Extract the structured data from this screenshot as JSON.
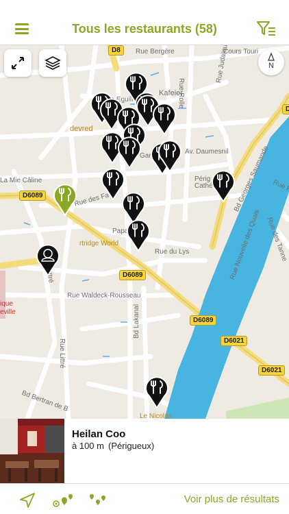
{
  "header": {
    "title": "Tous les restaurants (58)",
    "menu_icon": "hamburger-menu-icon",
    "filter_icon": "filter-icon",
    "accent_color": "#8aa824"
  },
  "map": {
    "controls": {
      "fullscreen_icon": "expand-icon",
      "layers_icon": "layers-icon",
      "compass_label": "N"
    },
    "roads": [
      {
        "id": "d8",
        "text": "D8",
        "type": "badge"
      },
      {
        "id": "d6089a",
        "text": "D6089",
        "type": "badge"
      },
      {
        "id": "d6089b",
        "text": "D6089",
        "type": "badge"
      },
      {
        "id": "d6089c",
        "text": "D6089",
        "type": "badge"
      },
      {
        "id": "d6021a",
        "text": "D6021",
        "type": "badge"
      },
      {
        "id": "d6021b",
        "text": "D6021",
        "type": "badge"
      },
      {
        "id": "dtop",
        "text": "D",
        "type": "badge"
      }
    ],
    "labels": [
      {
        "id": "bergere",
        "text": "Rue Bergère"
      },
      {
        "id": "cours",
        "text": "Cours Touri"
      },
      {
        "id": "rolle",
        "text": "Rue Rolle"
      },
      {
        "id": "kafeier",
        "text": "Kafeier"
      },
      {
        "id": "judaique",
        "text": "Rue Judaïque"
      },
      {
        "id": "eguillerie",
        "text": "ue Eguill"
      },
      {
        "id": "daumesnil",
        "text": "Av. Daumesnil"
      },
      {
        "id": "devred",
        "text": "devred"
      },
      {
        "id": "saumande",
        "text": "Bd Georges Saumande"
      },
      {
        "id": "mie",
        "text": "La Mie Câline"
      },
      {
        "id": "perig",
        "text": "Périg"
      },
      {
        "id": "cathe",
        "text": "Cathé"
      },
      {
        "id": "ruep",
        "text": "Rue P"
      },
      {
        "id": "fais",
        "text": "Rue des Fa"
      },
      {
        "id": "partridge",
        "text": "rtridge World"
      },
      {
        "id": "papa",
        "text": "Papa"
      },
      {
        "id": "lys",
        "text": "Rue du Lys"
      },
      {
        "id": "quais",
        "text": "Rue Nouvelle des Quais"
      },
      {
        "id": "tann",
        "text": "Rue des Tanne"
      },
      {
        "id": "waldeck",
        "text": "Rue Waldeck-Rousseau"
      },
      {
        "id": "littre1",
        "text": "Littré"
      },
      {
        "id": "littre2",
        "text": "Rue Littré"
      },
      {
        "id": "lakanal",
        "text": "Bd Lakanal"
      },
      {
        "id": "bertran",
        "text": "Bd Bertran de B"
      },
      {
        "id": "ique",
        "text": "ique"
      },
      {
        "id": "eville",
        "text": "eville"
      },
      {
        "id": "ng",
        "text": "Gar"
      },
      {
        "id": "nicolas",
        "text": "Le Nicolas"
      }
    ],
    "pins": [
      {
        "name": "restaurant-pin",
        "icon": "fork-knife-icon"
      },
      {
        "name": "restaurant-pin",
        "icon": "fork-knife-icon"
      },
      {
        "name": "restaurant-pin",
        "icon": "fork-knife-icon"
      },
      {
        "name": "restaurant-pin",
        "icon": "fork-knife-icon"
      },
      {
        "name": "restaurant-pin",
        "icon": "fork-knife-icon"
      },
      {
        "name": "restaurant-pin",
        "icon": "fork-knife-icon"
      },
      {
        "name": "restaurant-pin",
        "icon": "fork-knife-icon"
      },
      {
        "name": "restaurant-pin",
        "icon": "fork-knife-icon"
      },
      {
        "name": "restaurant-pin",
        "icon": "fork-knife-icon"
      },
      {
        "name": "restaurant-pin",
        "icon": "fork-knife-icon"
      },
      {
        "name": "restaurant-pin",
        "icon": "fork-knife-icon"
      },
      {
        "name": "restaurant-pin",
        "icon": "fork-knife-icon"
      },
      {
        "name": "restaurant-pin",
        "icon": "fork-knife-icon"
      },
      {
        "name": "restaurant-pin",
        "icon": "fork-knife-icon"
      },
      {
        "name": "restaurant-pin",
        "icon": "fork-knife-icon"
      },
      {
        "name": "restaurant-pin",
        "icon": "fork-knife-icon"
      },
      {
        "name": "restaurant-pin",
        "icon": "fork-knife-icon"
      },
      {
        "name": "restaurant-pin-selected",
        "icon": "fork-knife-icon",
        "color": "#8aa824"
      },
      {
        "name": "user-location-pin",
        "icon": "person-icon"
      }
    ]
  },
  "card": {
    "name": "Heilan Coo",
    "distance": "à 100 m",
    "city": "(Périgueux)",
    "photo_icon": "restaurant-photo"
  },
  "footer": {
    "more_label": "Voir plus de résultats",
    "icons": [
      "location-arrow-icon",
      "nearby-pins-icon",
      "all-pins-icon"
    ]
  }
}
